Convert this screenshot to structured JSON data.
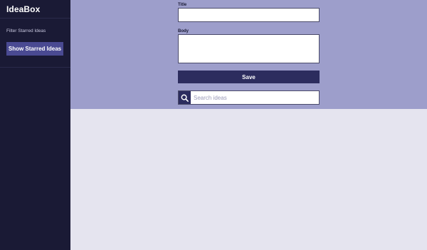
{
  "sidebar": {
    "brand": "IdeaBox",
    "filter_label": "Filter Starred Ideas",
    "starred_button_label": "Show Starred Ideas"
  },
  "form": {
    "title_label": "Title",
    "title_value": "",
    "body_label": "Body",
    "body_value": "",
    "save_label": "Save"
  },
  "search": {
    "placeholder": "Search ideas",
    "value": "",
    "icon": "magnifier-icon"
  },
  "colors": {
    "sidebar_bg": "#1a1a35",
    "form_bg": "#9d9ecb",
    "page_bg": "#e5e4ef",
    "accent_button": "#4a4a92",
    "save_button": "#2c2c5e"
  }
}
